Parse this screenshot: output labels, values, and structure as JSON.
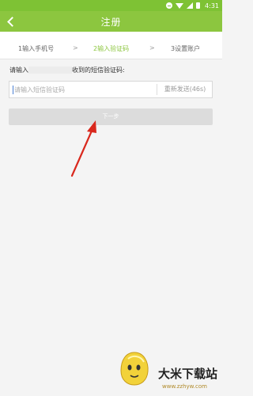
{
  "status_bar": {
    "time": "4:31"
  },
  "app_bar": {
    "title": "注册"
  },
  "steps": {
    "step1": "1输入手机号",
    "step2": "2输入验证码",
    "step3": "3设置账户",
    "arrow": ">"
  },
  "form": {
    "prompt_prefix": "请输入",
    "prompt_suffix": "收到的短信验证码:",
    "code_value": "",
    "code_placeholder": "请输入短信验证码",
    "resend_label": "重新发送(46s)"
  },
  "next_button": {
    "label": "下一步"
  },
  "watermark": {
    "brand": "大米下载站",
    "site": "www.zzhyw.com"
  },
  "colors": {
    "header": "#8cc63f",
    "status_bar": "#7ec234",
    "active_step": "#8cc63f",
    "arrow": "#d9281d"
  }
}
